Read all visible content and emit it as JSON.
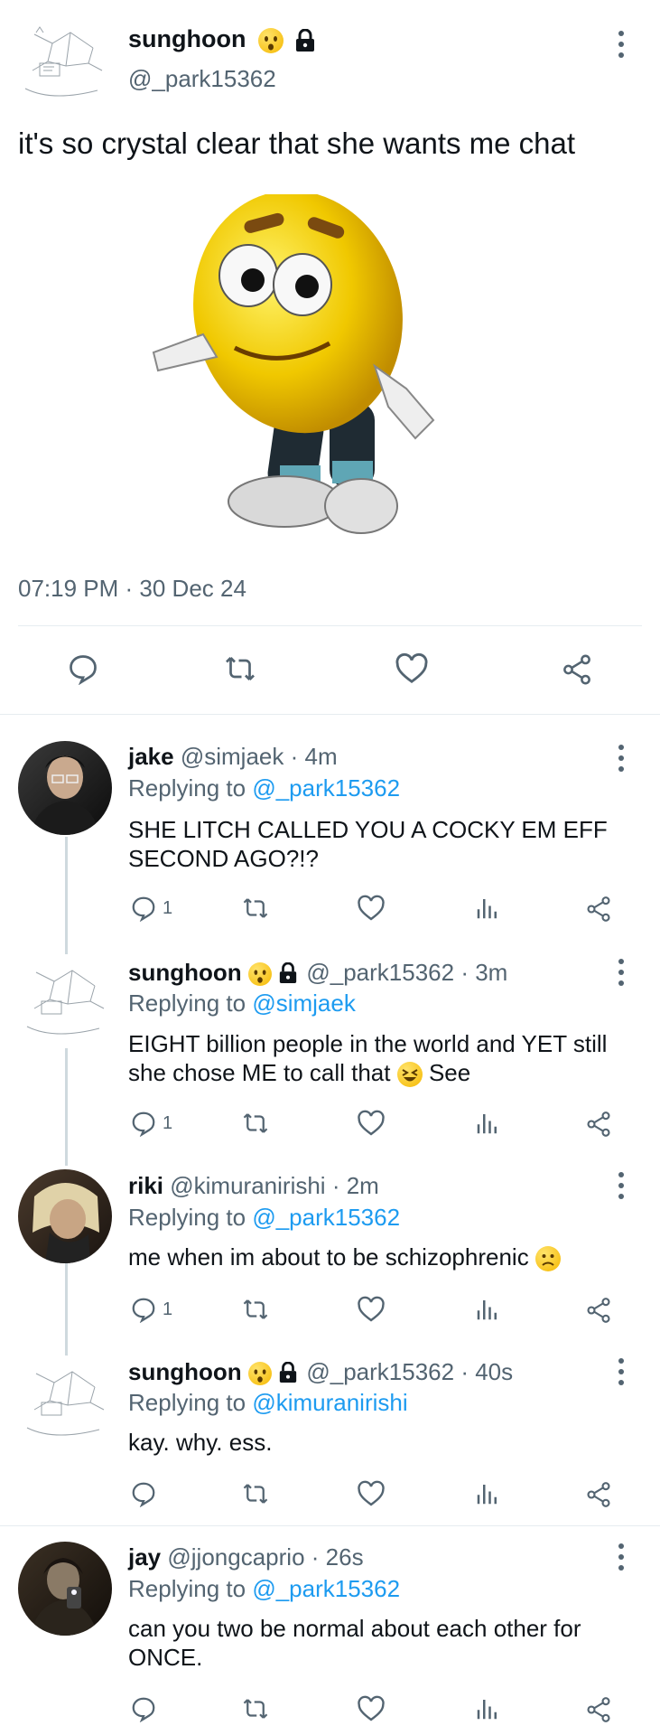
{
  "main_tweet": {
    "name": "sunghoon",
    "handle": "@_park15362",
    "text": "it's so crystal clear that she wants me chat",
    "timestamp": "07:19 PM · 30 Dec 24"
  },
  "replies": [
    {
      "name": "jake",
      "handle": "@simjaek",
      "time": "· 4m",
      "replying_prefix": "Replying to",
      "replying_to": "@_park15362",
      "text": "SHE LITCH CALLED YOU A COCKY EM EFF SECOND AGO?!?",
      "reply_count": "1"
    },
    {
      "name": "sunghoon",
      "handle": "@_park15362",
      "time": "· 3m",
      "replying_prefix": "Replying to",
      "replying_to": "@simjaek",
      "text_a": "EIGHT billion people in the world and YET still she chose ME to call that",
      "text_b": "See",
      "reply_count": "1"
    },
    {
      "name": "riki",
      "handle": "@kimuranirishi",
      "time": "· 2m",
      "replying_prefix": "Replying to",
      "replying_to": "@_park15362",
      "text": "me when im about to be schizophrenic",
      "reply_count": "1"
    },
    {
      "name": "sunghoon",
      "handle": "@_park15362",
      "time": "· 40s",
      "replying_prefix": "Replying to",
      "replying_to": "@kimuranirishi",
      "text": "kay. why. ess.",
      "reply_count": ""
    },
    {
      "name": "jay",
      "handle": "@jjongcaprio",
      "time": "· 26s",
      "replying_prefix": "Replying to",
      "replying_to": "@_park15362",
      "text": "can you two be normal about each other for ONCE.",
      "reply_count": ""
    }
  ],
  "colors": {
    "text": "#0f1419",
    "secondary": "#536471",
    "link": "#1d9bf0",
    "divider": "#e6ecf0"
  }
}
